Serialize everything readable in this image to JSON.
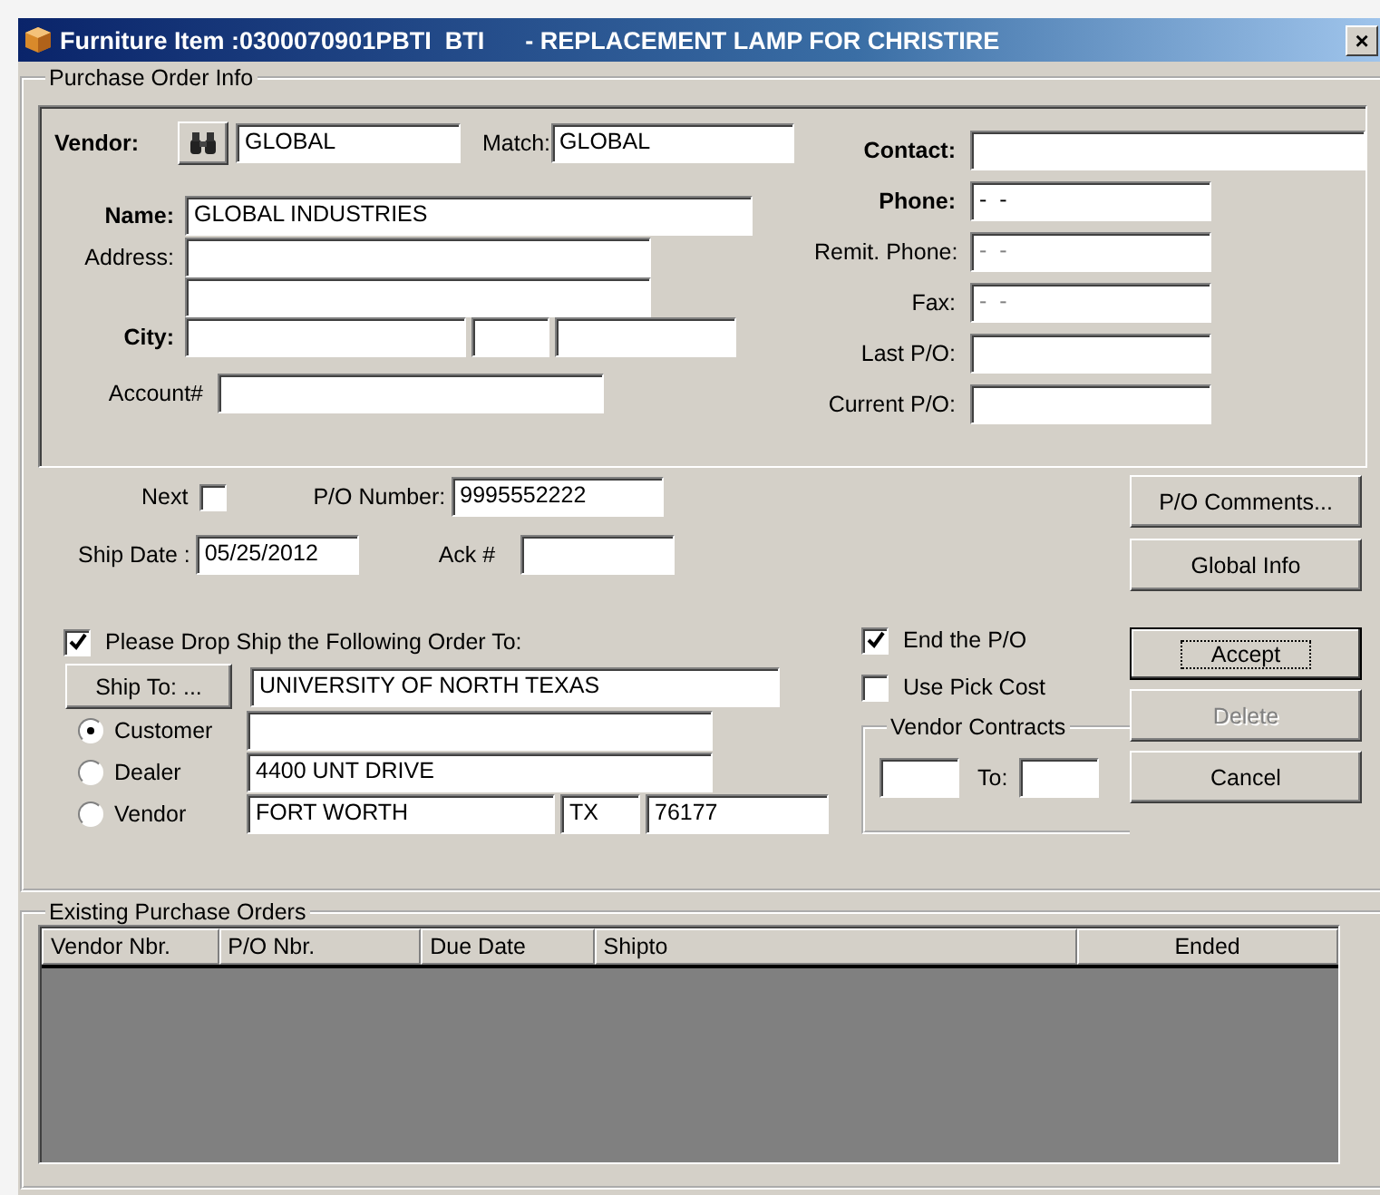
{
  "window": {
    "title": "Furniture Item :0300070901PBTI  BTI      - REPLACEMENT LAMP FOR CHRISTIRE",
    "close": "×"
  },
  "purchase_order_info": {
    "label": "Purchase Order Info",
    "vendor": {
      "label": "Vendor:",
      "value": "GLOBAL"
    },
    "match": {
      "label": "Match:",
      "value": "GLOBAL"
    },
    "name": {
      "label": "Name:",
      "value": "GLOBAL INDUSTRIES"
    },
    "address": {
      "label": "Address:"
    },
    "city": {
      "label": "City:"
    },
    "account": {
      "label": "Account#"
    },
    "contact_fields": [
      {
        "label": "Contact:",
        "bold": true
      },
      {
        "label": "Phone:",
        "bold": true,
        "value": "-  -"
      },
      {
        "label": "Remit. Phone:",
        "bold": false,
        "placeholder": "-  -"
      },
      {
        "label": "Fax:",
        "bold": false,
        "placeholder": "-  -"
      },
      {
        "label": "Last P/O:",
        "bold": false
      },
      {
        "label": "Current P/O:",
        "bold": false
      }
    ]
  },
  "order": {
    "next": {
      "label": "Next",
      "checked": false
    },
    "po_number": {
      "label": "P/O Number:",
      "value": "9995552222"
    },
    "ship_date": {
      "label": "Ship Date :",
      "value": "05/25/2012"
    },
    "ack": {
      "label": "Ack #"
    },
    "drop_ship": {
      "label": "Please Drop Ship the Following Order To:",
      "checked": true
    },
    "ship_to": {
      "button": "Ship To: ...",
      "name": "UNIVERSITY OF NORTH TEXAS",
      "street": "4400 UNT DRIVE",
      "city": "FORT WORTH",
      "state": "TX",
      "zip": "76177"
    },
    "ship_to_types": [
      {
        "label": "Customer",
        "selected": true
      },
      {
        "label": "Dealer",
        "selected": false
      },
      {
        "label": "Vendor",
        "selected": false
      }
    ],
    "options": [
      {
        "label": "End the P/O",
        "checked": true
      },
      {
        "label": "Use Pick Cost",
        "checked": false
      }
    ],
    "vendor_contracts": {
      "label": "Vendor Contracts",
      "to_label": "To:"
    },
    "side_buttons": [
      {
        "label": "P/O Comments...",
        "disabled": false,
        "default": false
      },
      {
        "label": "Global Info",
        "disabled": false,
        "default": false
      }
    ],
    "action_buttons": [
      {
        "label": "Accept",
        "disabled": false,
        "default": true
      },
      {
        "label": "Delete",
        "disabled": true,
        "default": false
      },
      {
        "label": "Cancel",
        "disabled": false,
        "default": false
      }
    ]
  },
  "existing_orders": {
    "label": "Existing Purchase Orders",
    "columns": [
      {
        "label": "Vendor Nbr.",
        "centered": false
      },
      {
        "label": "P/O Nbr.",
        "centered": false
      },
      {
        "label": "Due Date",
        "centered": false
      },
      {
        "label": "Shipto",
        "centered": false
      },
      {
        "label": "Ended",
        "centered": true
      }
    ]
  }
}
